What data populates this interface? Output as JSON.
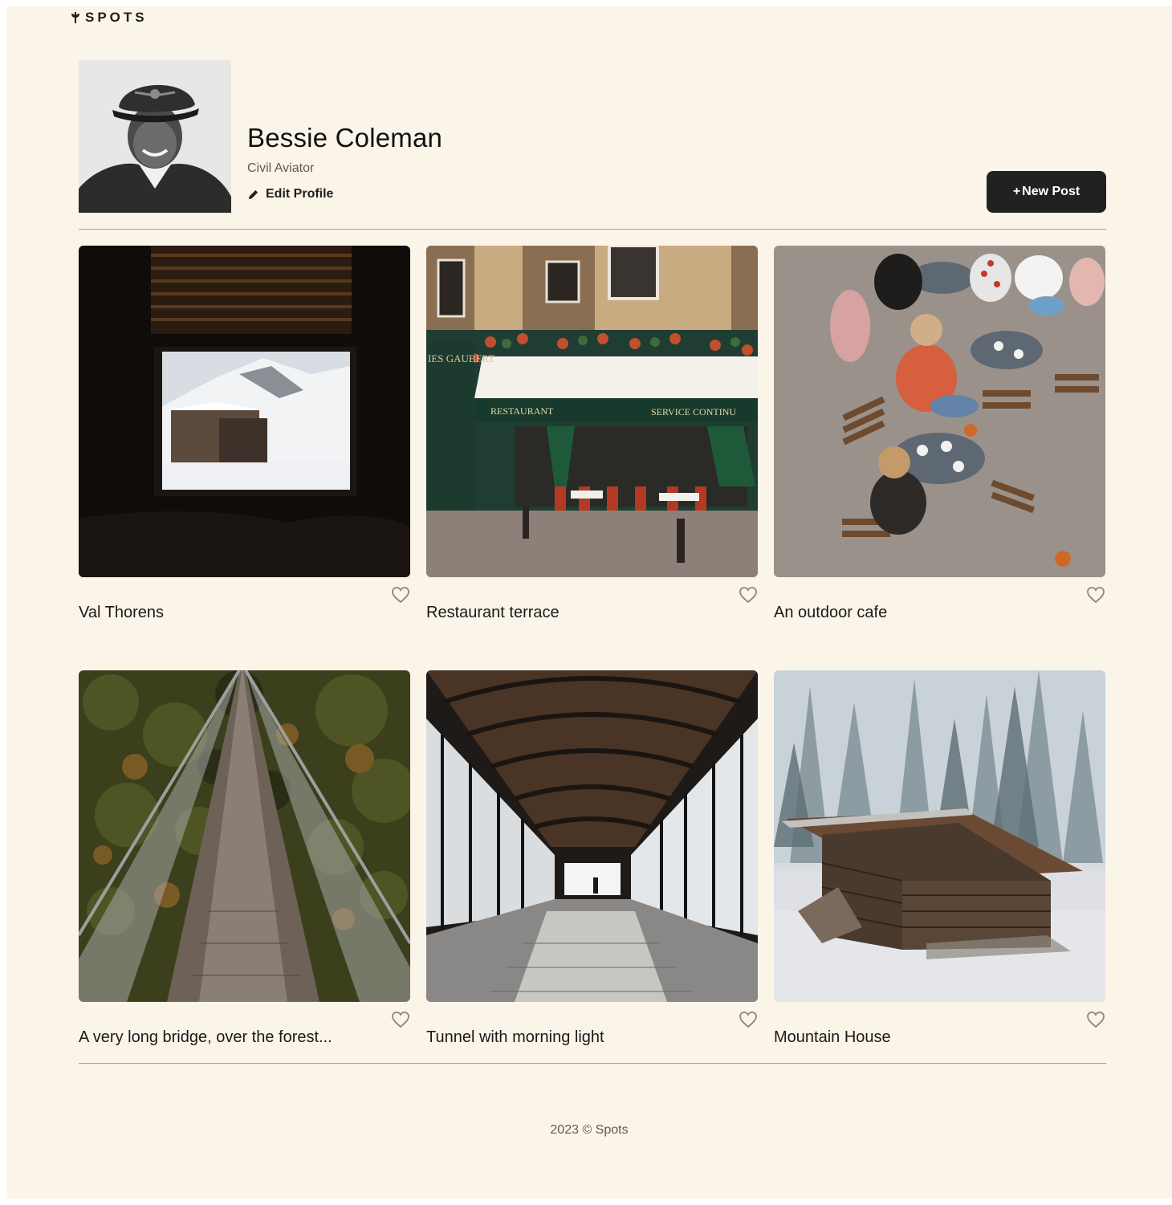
{
  "header": {
    "logo_text": "SPOTS"
  },
  "profile": {
    "name": "Bessie Coleman",
    "role": "Civil Aviator",
    "edit_label": "Edit Profile",
    "new_post_label": "New Post",
    "new_post_symbol": "+"
  },
  "cards": [
    {
      "title": "Val Thorens"
    },
    {
      "title": "Restaurant terrace"
    },
    {
      "title": "An outdoor cafe"
    },
    {
      "title": "A very long bridge, over the forest..."
    },
    {
      "title": "Tunnel with morning light"
    },
    {
      "title": "Mountain House"
    }
  ],
  "footer": {
    "text": "2023 © Spots"
  },
  "colors": {
    "page_bg": "#fbf4e8",
    "button_bg": "#212121",
    "divider": "#a8a29a",
    "text_secondary": "#5e5a55"
  },
  "icons": {
    "logo": "sprout-icon",
    "edit": "pencil-icon",
    "like": "heart-outline-icon"
  }
}
